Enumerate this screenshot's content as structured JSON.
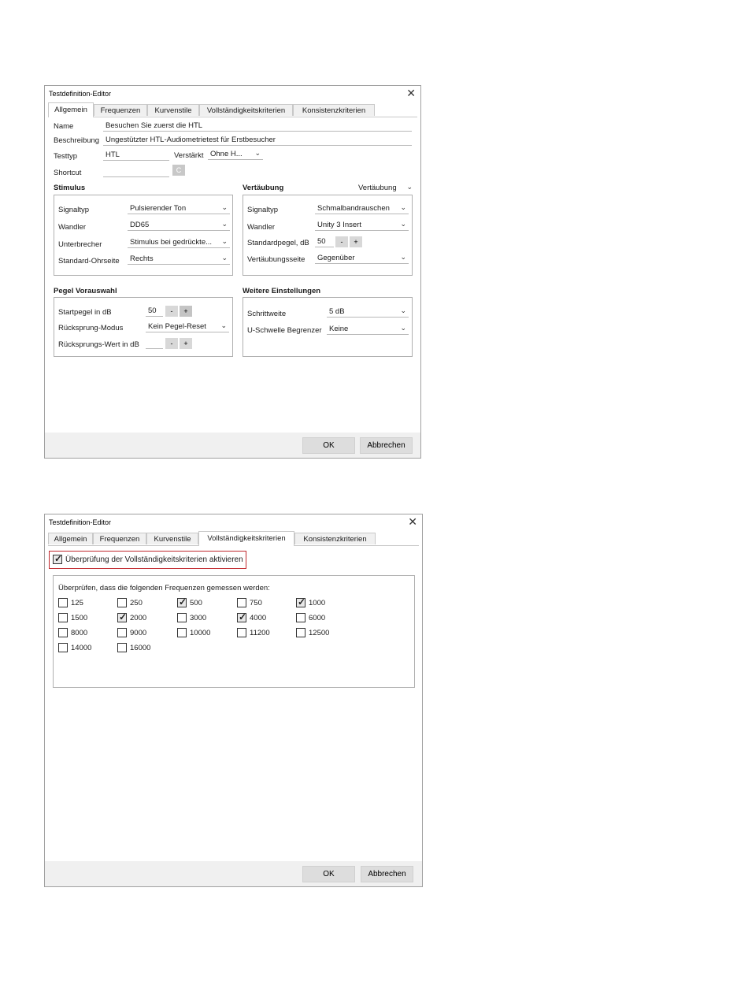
{
  "dialog1": {
    "title": "Testdefinition-Editor",
    "close_glyph": "✕",
    "tabs": [
      "Allgemein",
      "Frequenzen",
      "Kurvenstile",
      "Vollständigkeitskriterien",
      "Konsistenzkriterien"
    ],
    "active_tab": "Allgemein",
    "name_label": "Name",
    "name_value": "Besuchen Sie zuerst die HTL",
    "desc_label": "Beschreibung",
    "desc_value": "Ungestützter HTL-Audiometrietest für Erstbesucher",
    "testtyp_label": "Testtyp",
    "testtyp_value": "HTL",
    "verstaerkt_label": "Verstärkt",
    "verstaerkt_value": "Ohne H...",
    "shortcut_label": "Shortcut",
    "shortcut_btn": "C",
    "stimulus_header": "Stimulus",
    "stimulus": {
      "signaltyp_label": "Signaltyp",
      "signaltyp_value": "Pulsierender Ton",
      "wandler_label": "Wandler",
      "wandler_value": "DD65",
      "unterbrecher_label": "Unterbrecher",
      "unterbrecher_value": "Stimulus bei gedrückte...",
      "ohrseite_label": "Standard-Ohrseite",
      "ohrseite_value": "Rechts"
    },
    "vert_header": "Vertäubung",
    "vert_dropdown": "Vertäubung",
    "vert": {
      "signaltyp_label": "Signaltyp",
      "signaltyp_value": "Schmalbandrauschen",
      "wandler_label": "Wandler",
      "wandler_value": "Unity 3 Insert",
      "pegel_label": "Standardpegel, dB",
      "pegel_value": "50",
      "seite_label": "Vertäubungsseite",
      "seite_value": "Gegenüber"
    },
    "pegel_header": "Pegel Vorauswahl",
    "pegel": {
      "start_label": "Startpegel in dB",
      "start_value": "50",
      "modus_label": "Rücksprung-Modus",
      "modus_value": "Kein Pegel-Reset",
      "wert_label": "Rücksprungs-Wert in dB",
      "wert_value": ""
    },
    "weitere_header": "Weitere Einstellungen",
    "weitere": {
      "schritt_label": "Schrittweite",
      "schritt_value": "5 dB",
      "uschwelle_label": "U-Schwelle Begrenzer",
      "uschwelle_value": "Keine"
    },
    "minus": "-",
    "plus": "+",
    "ok": "OK",
    "cancel": "Abbrechen"
  },
  "dialog2": {
    "title": "Testdefinition-Editor",
    "close_glyph": "✕",
    "tabs": [
      "Allgemein",
      "Frequenzen",
      "Kurvenstile",
      "Vollständigkeitskriterien",
      "Konsistenzkriterien"
    ],
    "active_tab": "Vollständigkeitskriterien",
    "enable_label": "Überprüfung der Vollständigkeitskriterien aktivieren",
    "enable_checked": true,
    "freq_intro": "Überprüfen, dass die folgenden Frequenzen gemessen werden:",
    "frequencies": [
      {
        "label": "125",
        "checked": false
      },
      {
        "label": "250",
        "checked": false
      },
      {
        "label": "500",
        "checked": true
      },
      {
        "label": "750",
        "checked": false
      },
      {
        "label": "1000",
        "checked": true
      },
      {
        "label": "1500",
        "checked": false
      },
      {
        "label": "2000",
        "checked": true
      },
      {
        "label": "3000",
        "checked": false
      },
      {
        "label": "4000",
        "checked": true
      },
      {
        "label": "6000",
        "checked": false
      },
      {
        "label": "8000",
        "checked": false
      },
      {
        "label": "9000",
        "checked": false
      },
      {
        "label": "10000",
        "checked": false
      },
      {
        "label": "11200",
        "checked": false
      },
      {
        "label": "12500",
        "checked": false
      },
      {
        "label": "14000",
        "checked": false
      },
      {
        "label": "16000",
        "checked": false
      }
    ],
    "ok": "OK",
    "cancel": "Abbrechen"
  },
  "colors": {
    "highlight_border": "#c0282d",
    "footer_bg": "#f0f0f0",
    "button_bg": "#dddddd"
  }
}
